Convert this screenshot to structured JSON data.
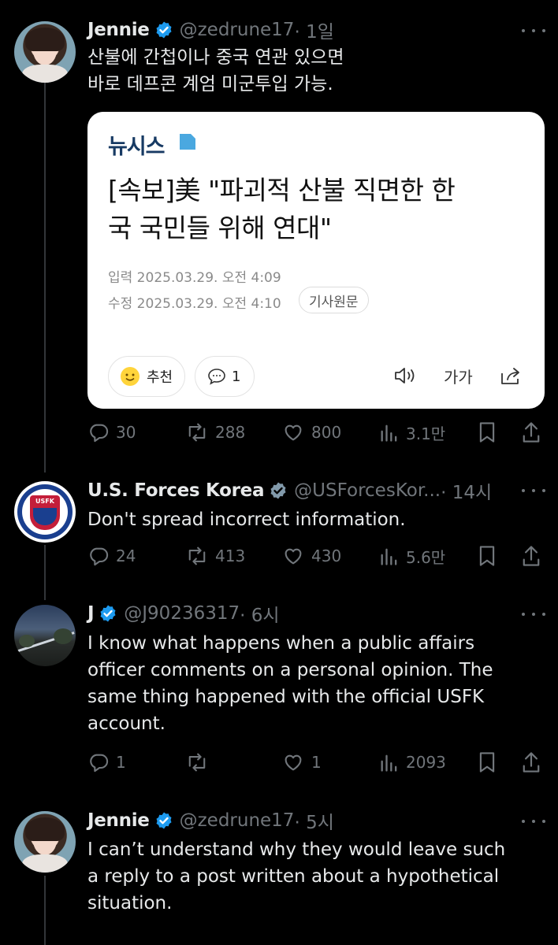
{
  "posts": [
    {
      "name": "Jennie",
      "handle": "@zedrune17",
      "time": "· 1일",
      "text": "산불에 간첩이나 중국 연관 있으면\n바로 데프콘 계엄 미군투입 가능.",
      "card": {
        "source": "뉴시스",
        "headline": "[속보]美 \"파괴적 산불 직면한 한\n국 국민들 위해 연대\"",
        "published": "입력 2025.03.29. 오전 4:09",
        "modified": "수정 2025.03.29. 오전 4:10",
        "original_label": "기사원문",
        "recommend_label": "추천",
        "comment_count": "1",
        "font_size_label": "가가"
      },
      "stats": {
        "replies": "30",
        "reposts": "288",
        "likes": "800",
        "views": "3.1만"
      }
    },
    {
      "name": "U.S. Forces Korea",
      "handle": "@USForcesKor...",
      "time": "· 14시",
      "avatar_text": "USFK",
      "text": "Don't spread incorrect information.",
      "stats": {
        "replies": "24",
        "reposts": "413",
        "likes": "430",
        "views": "5.6만"
      }
    },
    {
      "name": "J",
      "handle": "@J90236317",
      "time": "· 6시",
      "text": "I know what happens when a public affairs\nofficer comments on a personal opinion. The\nsame thing happened with the official USFK\naccount.",
      "stats": {
        "replies": "1",
        "reposts": "",
        "likes": "1",
        "views": "2093"
      }
    },
    {
      "name": "Jennie",
      "handle": "@zedrune17",
      "time": "· 5시",
      "text": "I can’t understand why they would leave such\na reply to a post written about a hypothetical\nsituation."
    }
  ],
  "icons": [
    "verified-badge-icon",
    "more-icon",
    "reply-icon",
    "repost-icon",
    "like-icon",
    "views-icon",
    "bookmark-icon",
    "share-icon",
    "smile-icon",
    "comment-icon",
    "speaker-icon",
    "share-arrow-icon"
  ],
  "colors": {
    "background": "#000000",
    "verified_blue": "#1d9bf0",
    "gov_badge_gray": "#829aab",
    "muted": "#71767b"
  }
}
